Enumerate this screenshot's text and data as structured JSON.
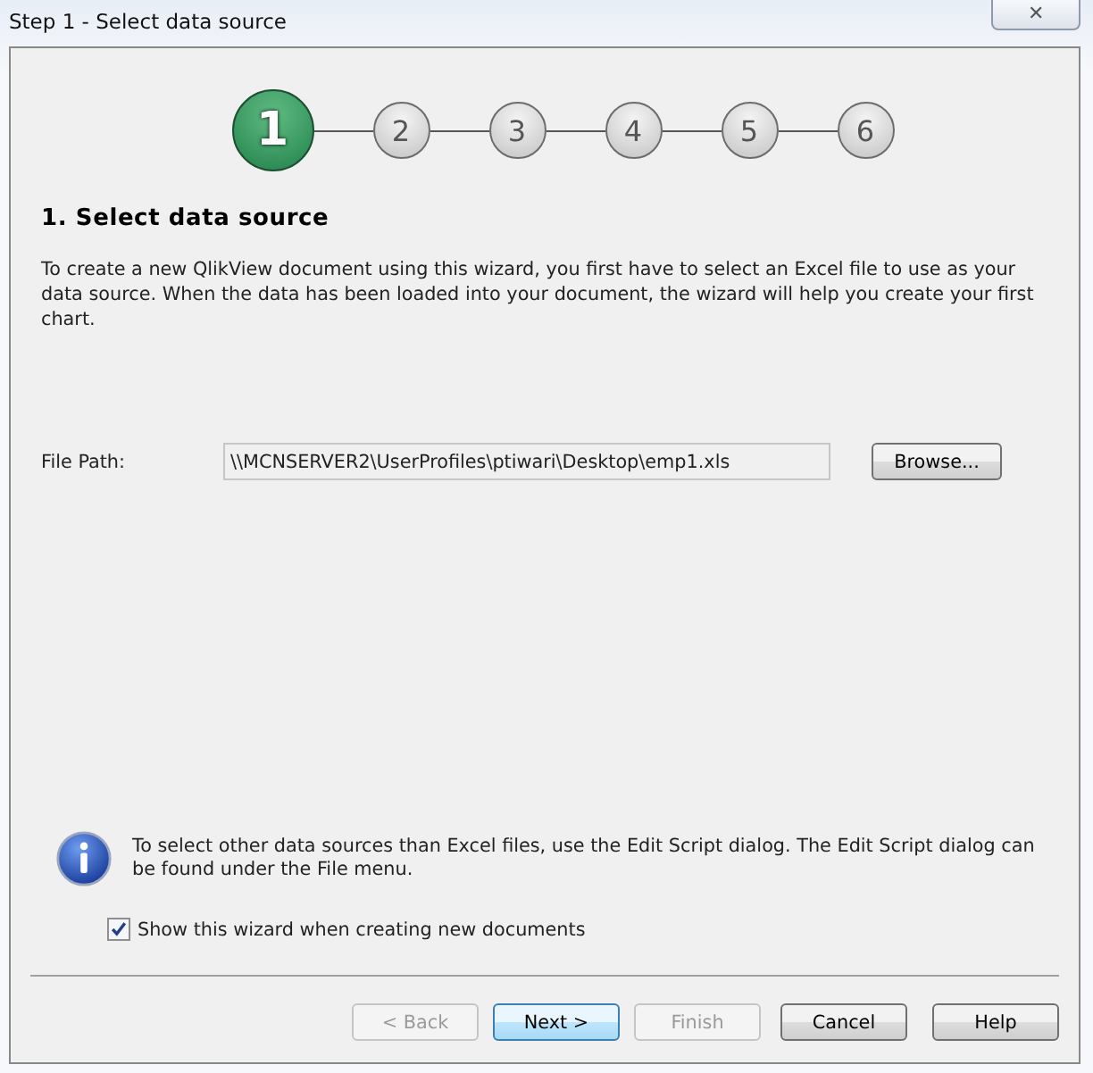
{
  "window": {
    "title": "Step 1 - Select data source",
    "close": "✕"
  },
  "steps": [
    {
      "label": "1",
      "selected": true
    },
    {
      "label": "2",
      "selected": false
    },
    {
      "label": "3",
      "selected": false
    },
    {
      "label": "4",
      "selected": false
    },
    {
      "label": "5",
      "selected": false
    },
    {
      "label": "6",
      "selected": false
    }
  ],
  "heading": "1. Select data source",
  "description": "To create a new QlikView document using this wizard, you first have to select an Excel file to use as your data source. When the data has been loaded into your document, the wizard will help you create your first chart.",
  "file_path": {
    "label": "File Path:",
    "value": "\\\\MCNSERVER2\\UserProfiles\\ptiwari\\Desktop\\emp1.xls",
    "button": "Browse..."
  },
  "info": "To select other data sources than Excel files, use the Edit Script dialog. The Edit Script dialog can be found under the File menu.",
  "show_wizard": {
    "label": "Show this wizard when creating new documents",
    "checked": true
  },
  "buttons": [
    {
      "label": "< Back",
      "disabled": true,
      "default": false
    },
    {
      "label": "Next >",
      "disabled": false,
      "default": true
    },
    {
      "label": "Finish",
      "disabled": true,
      "default": false
    },
    {
      "label": "Cancel",
      "disabled": false,
      "default": false
    },
    {
      "label": "Help",
      "disabled": false,
      "default": false
    }
  ]
}
